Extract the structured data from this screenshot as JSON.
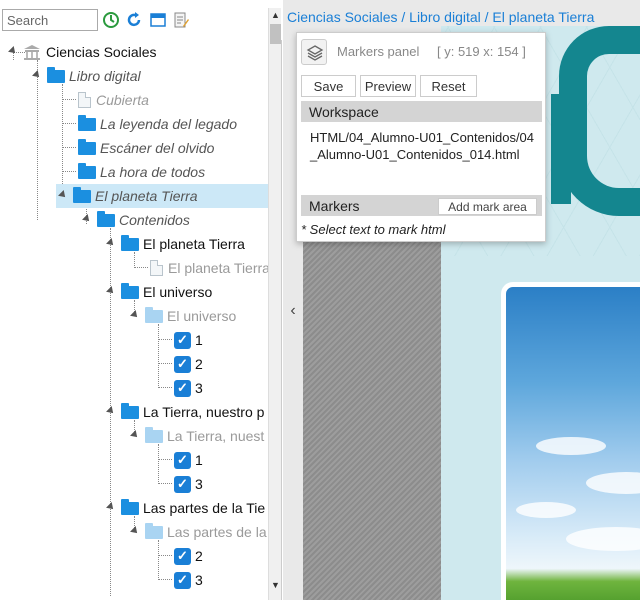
{
  "toolbar": {
    "search_placeholder": "Search",
    "icons": [
      "sync-icon",
      "refresh-icon",
      "window-icon",
      "document-edit-icon"
    ]
  },
  "tree": {
    "root": "Ciencias Sociales",
    "book": "Libro digital",
    "items": [
      {
        "label": "Cubierta",
        "kind": "page"
      },
      {
        "label": "La leyenda del legado",
        "kind": "folder"
      },
      {
        "label": "Escáner del olvido",
        "kind": "folder"
      },
      {
        "label": "La hora de todos",
        "kind": "folder"
      },
      {
        "label": "El planeta Tierra",
        "kind": "folder",
        "selected": true
      }
    ],
    "contenidos": "Contenidos",
    "sections": [
      {
        "label": "El planeta Tierra",
        "child": "El planeta Tierra",
        "checks": []
      },
      {
        "label": "El universo",
        "child": "El universo",
        "checks": [
          "1",
          "2",
          "3"
        ]
      },
      {
        "label": "La Tierra, nuestro p",
        "child": "La Tierra, nuest",
        "checks": [
          "1",
          "3"
        ]
      },
      {
        "label": "Las partes de la Tie",
        "child": "Las partes de la",
        "checks": [
          "2",
          "3"
        ]
      }
    ]
  },
  "breadcrumb": "Ciencias Sociales / Libro digital / El planeta Tierra",
  "markers_panel": {
    "title": "Markers panel",
    "coords": "[ y: 519 x: 154 ]",
    "buttons": {
      "save": "Save",
      "preview": "Preview",
      "reset": "Reset"
    },
    "workspace_label": "Workspace",
    "workspace_path": "HTML/04_Alumno-U01_Contenidos/04_Alumno-U01_Contenidos_014.html",
    "markers_label": "Markers",
    "add_mark_area": "Add mark area",
    "hint": "* Select text to mark html"
  },
  "colors": {
    "accent": "#1a7fd6",
    "folder": "#1b8fe0",
    "teal": "#14868f",
    "selected_row": "#cce8f7"
  }
}
